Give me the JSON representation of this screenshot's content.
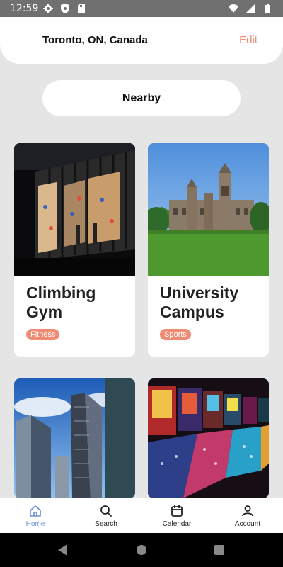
{
  "status_bar": {
    "time": "12:59"
  },
  "header": {
    "location": "Toronto, ON, Canada",
    "edit_label": "Edit"
  },
  "filter": {
    "label": "Nearby"
  },
  "cards": [
    {
      "title": "Climbing Gym",
      "tag": "Fitness"
    },
    {
      "title": "University Campus",
      "tag": "Sports"
    },
    {
      "title": "",
      "tag": ""
    },
    {
      "title": "",
      "tag": ""
    }
  ],
  "nav": {
    "items": [
      {
        "label": "Home",
        "icon": "home-icon"
      },
      {
        "label": "Search",
        "icon": "search-icon"
      },
      {
        "label": "Calendar",
        "icon": "calendar-icon"
      },
      {
        "label": "Account",
        "icon": "account-icon"
      }
    ]
  },
  "colors": {
    "accent": "#f08a72",
    "active_nav": "#6c8fd8",
    "background": "#e5e5e5"
  }
}
